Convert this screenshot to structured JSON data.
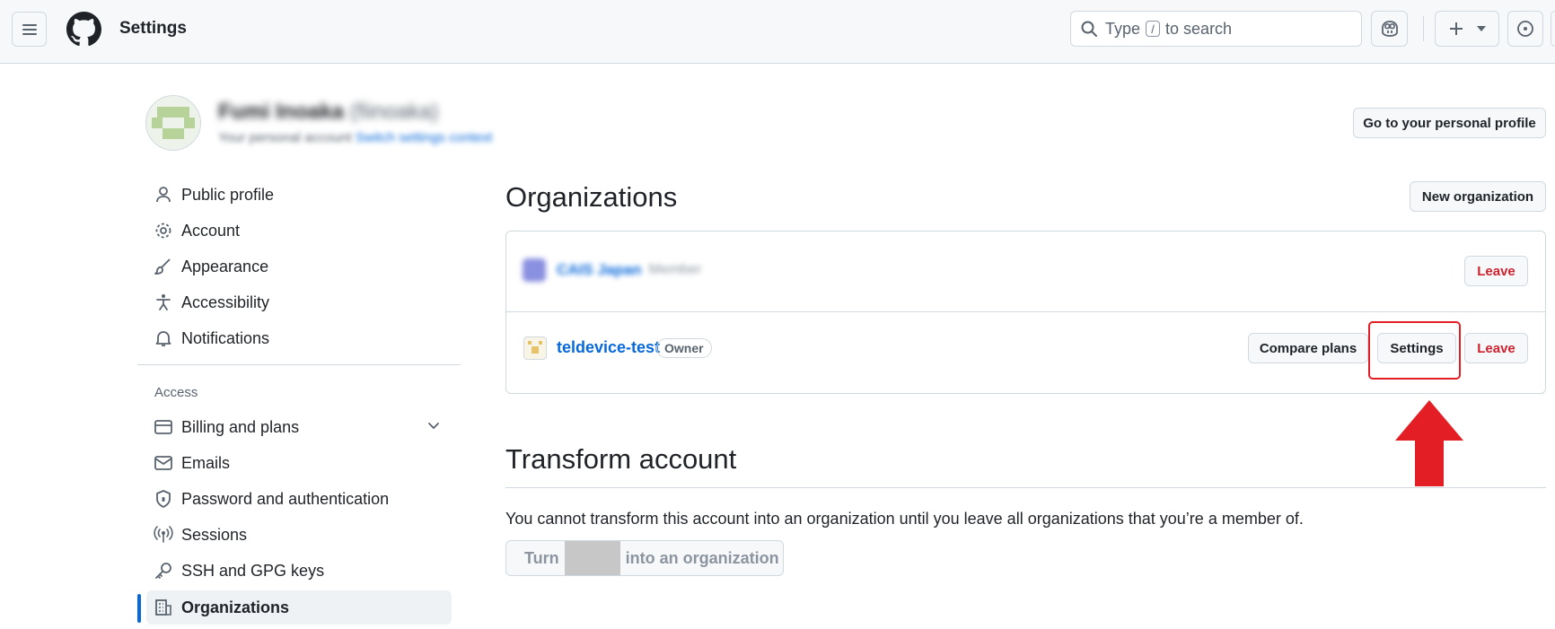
{
  "header": {
    "title": "Settings",
    "search": {
      "prefix": "Type",
      "key": "/",
      "suffix": "to search"
    }
  },
  "context": {
    "name": "Fumi Inoaka",
    "handle": "(fiinoaka)",
    "subtitle": "Your personal account",
    "switch_link": "Switch settings context",
    "profile_button": "Go to your personal profile"
  },
  "sidebar": {
    "items": [
      {
        "label": "Public profile",
        "icon": "person-icon"
      },
      {
        "label": "Account",
        "icon": "gear-icon"
      },
      {
        "label": "Appearance",
        "icon": "paintbrush-icon"
      },
      {
        "label": "Accessibility",
        "icon": "accessibility-icon"
      },
      {
        "label": "Notifications",
        "icon": "bell-icon"
      }
    ],
    "access_heading": "Access",
    "access_items": [
      {
        "label": "Billing and plans",
        "icon": "credit-card-icon"
      },
      {
        "label": "Emails",
        "icon": "mail-icon"
      },
      {
        "label": "Password and authentication",
        "icon": "shield-lock-icon"
      },
      {
        "label": "Sessions",
        "icon": "broadcast-icon"
      },
      {
        "label": "SSH and GPG keys",
        "icon": "key-icon"
      },
      {
        "label": "Organizations",
        "icon": "organization-icon"
      }
    ]
  },
  "main": {
    "orgs_heading": "Organizations",
    "new_org_button": "New organization",
    "orgs": [
      {
        "name": "CAIS Japan",
        "role": "Member",
        "leave": "Leave"
      },
      {
        "name": "teldevice-test",
        "role": "Owner",
        "compare": "Compare plans",
        "settings": "Settings",
        "leave": "Leave"
      }
    ],
    "transform_heading": "Transform account",
    "transform_text": "You cannot transform this account into an organization until you leave all organizations that you’re a member of.",
    "transform_btn_prefix": "Turn",
    "transform_btn_suffix": "into an organization"
  },
  "colors": {
    "accent": "#0969da",
    "danger": "#cf222e",
    "annotation": "#e31e24"
  }
}
